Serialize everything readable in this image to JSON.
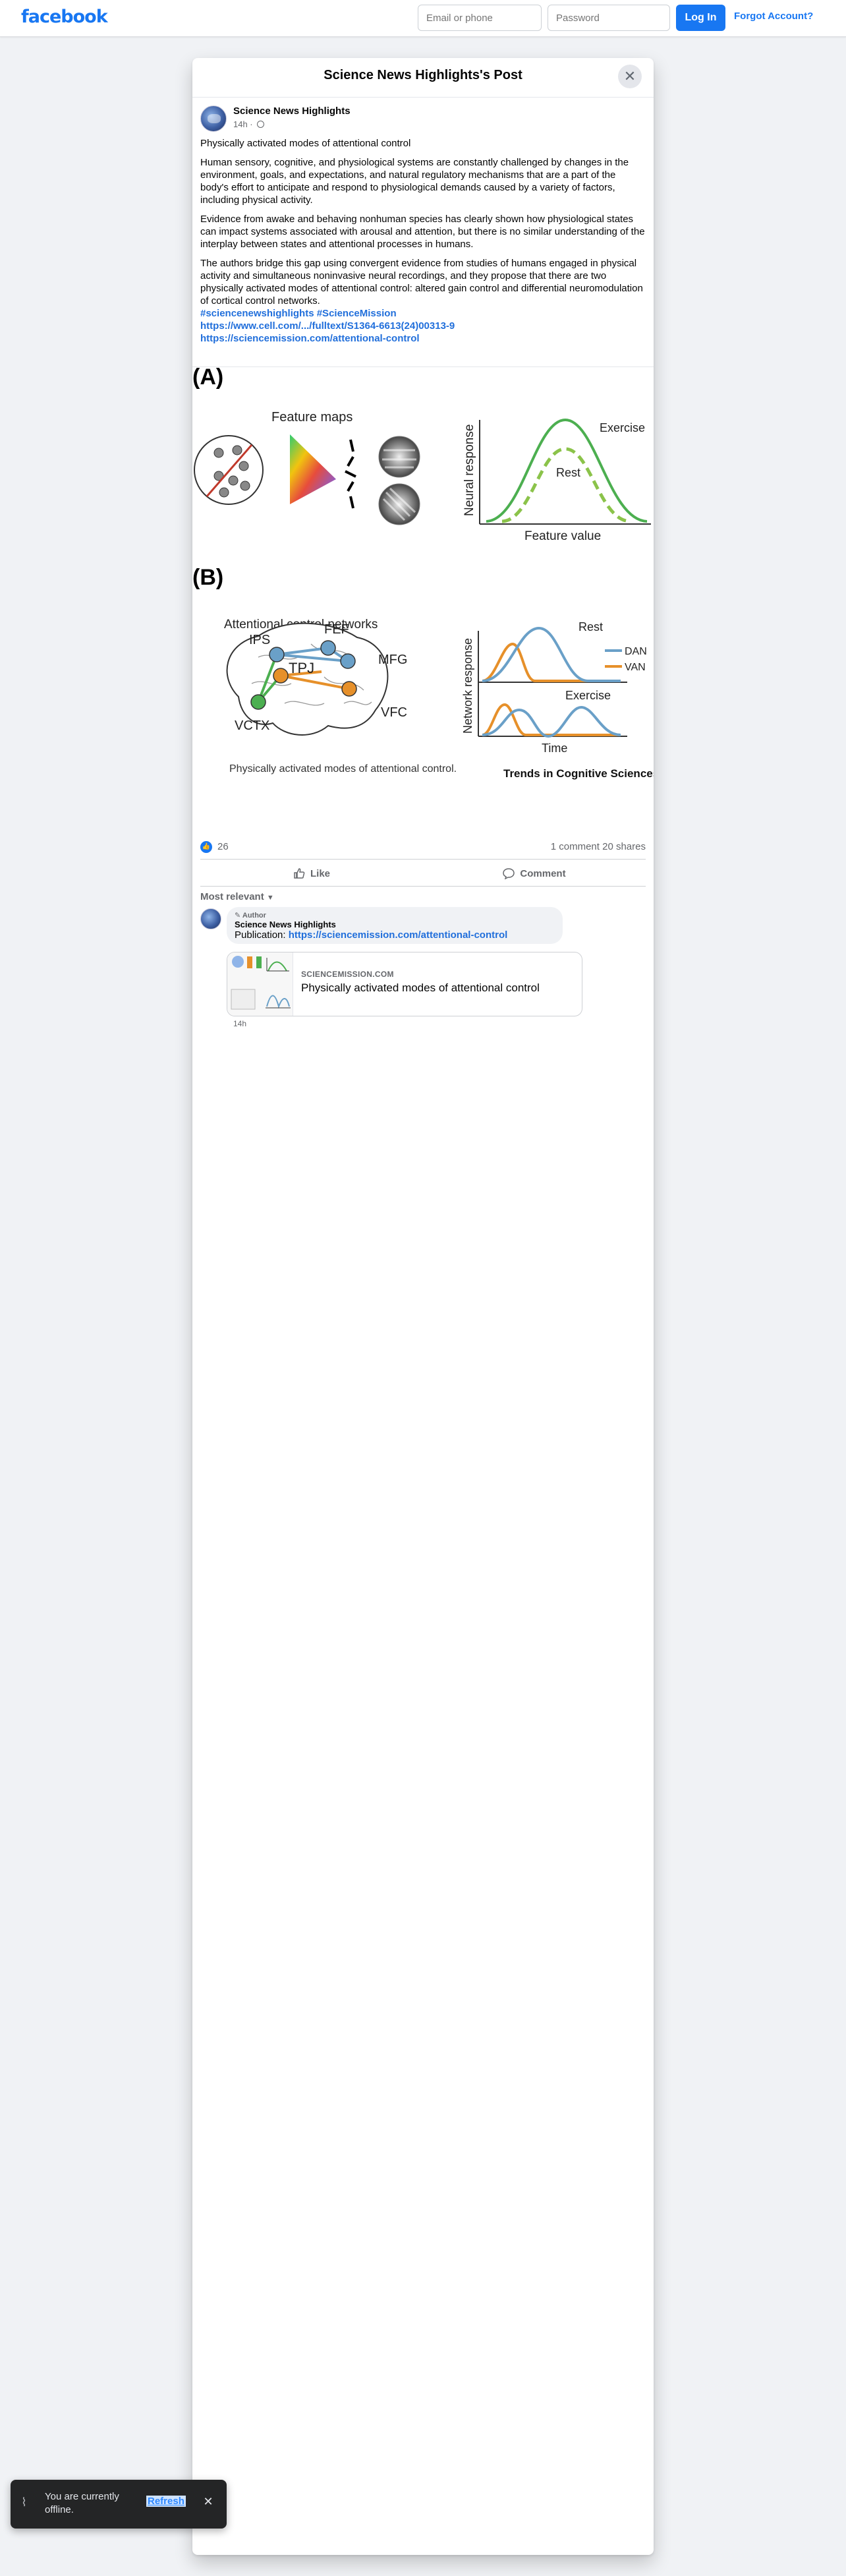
{
  "topbar": {
    "logo": "facebook",
    "email_placeholder": "Email or phone",
    "password_placeholder": "Password",
    "login_label": "Log In",
    "forgot_label": "Forgot Account?",
    "brand_color": "#1877f2"
  },
  "dialog": {
    "title": "Science News Highlights's Post",
    "close_icon": "close-icon"
  },
  "post": {
    "author": "Science News Highlights",
    "time": "14h ·",
    "privacy_icon": "globe-icon",
    "title": "Physically activated modes of attentional control",
    "paragraphs": [
      "Human sensory, cognitive, and physiological systems are constantly challenged by changes in the environment, goals, and expectations, and natural regulatory mechanisms that are a part of the body's effort to anticipate and respond to physiological demands caused by a variety of factors, including physical activity.",
      "Evidence from awake and behaving nonhuman species has clearly shown how physiological states can impact systems associated with arousal and attention, but there is no similar understanding of the interplay between states and attentional processes in humans.",
      "The authors bridge this gap using convergent evidence from studies of humans engaged in physical activity and simultaneous noninvasive neural recordings, and they propose that there are two physically activated modes of attentional control: altered gain control and differential neuromodulation of cortical control networks."
    ],
    "hashtags": "#sciencenewshighlights #ScienceMission",
    "link1": "https://www.cell.com/.../fulltext/S1364-6613(24)00313-9",
    "link2": "https://sciencemission.com/attentional-control"
  },
  "figure": {
    "panel_a_label": "(A)",
    "panel_b_label": "(B)",
    "feature_maps": "Feature maps",
    "neural_response": "Neural response",
    "feature_value": "Feature value",
    "exercise": "Exercise",
    "rest": "Rest",
    "attn_networks": "Attentional control networks",
    "region_ips": "IPS",
    "region_fef": "FEF",
    "region_mfg": "MFG",
    "region_tpj": "TPJ",
    "region_vctx": "VCTX",
    "region_vfc": "VFC",
    "network_response": "Network response",
    "time": "Time",
    "dan": "DAN",
    "van": "VAN",
    "caption": "Physically activated modes of attentional control.",
    "journal": "Trends in Cognitive Sciences",
    "colors": {
      "green": "#4caf50",
      "blue": "#6aa0c8",
      "orange": "#e6902a"
    }
  },
  "engagement": {
    "like_icon": "thumbs-up-icon",
    "likes": "26",
    "summary": "1 comment  20 shares"
  },
  "actions": {
    "like_label": "Like",
    "comment_label": "Comment"
  },
  "comments": {
    "sort_label": "Most relevant",
    "badge": "Author",
    "author": "Science News Highlights",
    "text_prefix": "Publication:",
    "text_link": "https://sciencemission.com/attentional-control",
    "card_domain": "SCIENCEMISSION.COM",
    "card_title": "Physically activated modes of attentional control",
    "time": "14h"
  },
  "toast": {
    "message": "You are currently offline.",
    "refresh_label": "Refresh"
  }
}
